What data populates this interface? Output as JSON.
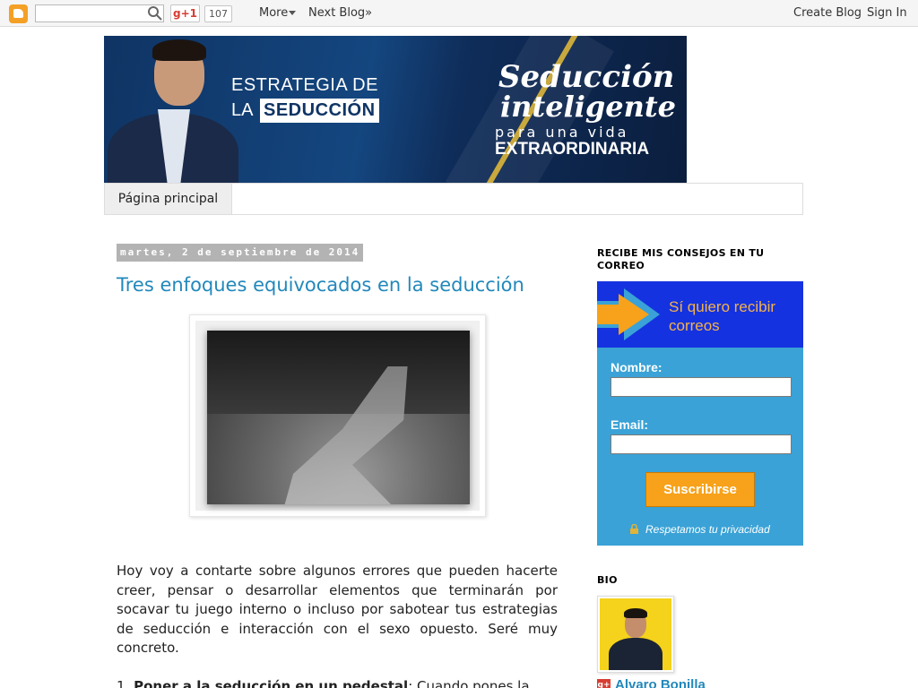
{
  "navbar": {
    "gplus_label": "g+1",
    "gplus_count": "107",
    "more_label": "More",
    "next_blog_label": "Next Blog»",
    "create_blog_label": "Create Blog",
    "sign_in_label": "Sign In",
    "search_placeholder": ""
  },
  "header": {
    "banner_line1": "ESTRATEGIA DE",
    "banner_line2a": "LA",
    "banner_line2b": "SEDUCCIÓN",
    "slogan_1": "Seducción",
    "slogan_2": "inteligente",
    "slogan_3": "para una vida",
    "slogan_4": "EXTRAORDINARIA"
  },
  "tabs": {
    "home_label": "Página principal"
  },
  "post": {
    "date": "martes, 2 de septiembre de 2014",
    "title": "Tres enfoques equivocados en la seducción",
    "paragraph1": "Hoy voy a contarte sobre algunos errores que pueden hacerte creer, pensar o desarrollar elementos que terminarán por socavar tu juego interno o incluso por sabotear tus estrategias de seducción e interacción con el sexo opuesto. Seré muy concreto.",
    "item1_number": "1.",
    "item1_bold": "Poner a la seducción en un pedestal",
    "item1_rest": ": Cuando pones la"
  },
  "sidebar": {
    "subscribe_title": "RECIBE MIS CONSEJOS EN TU CORREO",
    "optin_heading": "Sí quiero recibir correos",
    "name_label": "Nombre:",
    "email_label": "Email:",
    "submit_label": "Suscribirse",
    "privacy_text": "Respetamos tu privacidad",
    "bio_title": "BIO",
    "bio_gplus": "g+",
    "bio_name": "Alvaro Bonilla"
  },
  "colors": {
    "link_blue": "#2288bb",
    "optin_blue": "#3aa2d6",
    "optin_header": "#1532e0",
    "submit_orange": "#f7a21a"
  }
}
